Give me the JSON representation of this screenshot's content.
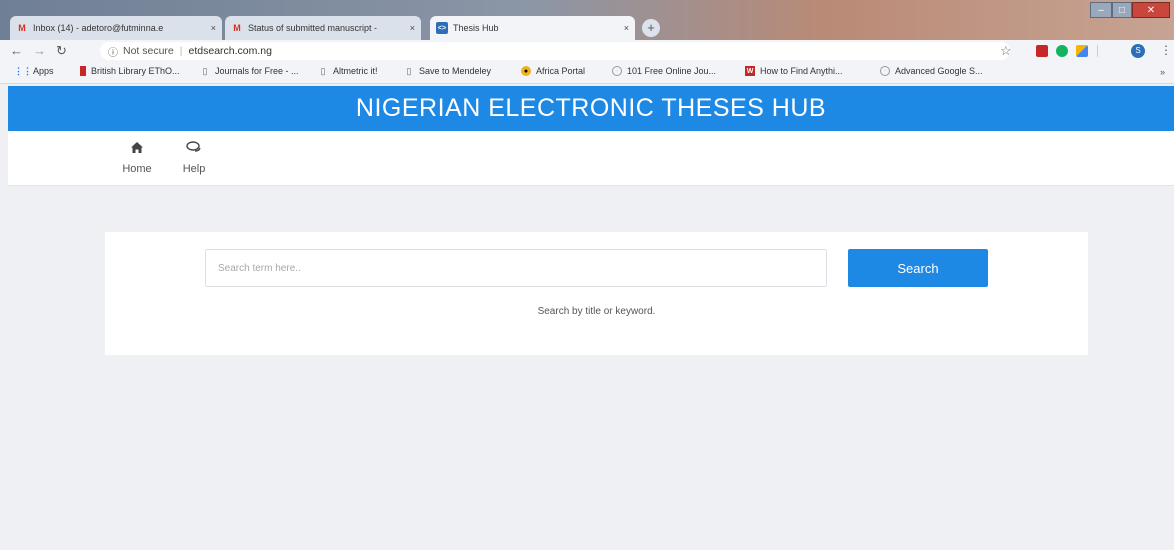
{
  "browser": {
    "tabs": [
      {
        "title": "Inbox (14) - adetoro@futminna.e",
        "icon": "gmail-icon",
        "close": "×"
      },
      {
        "title": "Status of submitted manuscript -",
        "icon": "gmail-icon",
        "close": "×"
      },
      {
        "title": "Thesis Hub",
        "icon": "thesis-hub-favicon",
        "close": "×"
      }
    ],
    "new_tab": "+",
    "address": {
      "security": "Not secure",
      "url": "etdsearch.com.ng"
    },
    "bookmarks": [
      {
        "label": "Apps",
        "icon": "apps-grid-icon"
      },
      {
        "label": "British Library EThO...",
        "icon": "bookmark-icon"
      },
      {
        "label": "Journals for Free - ...",
        "icon": "page-icon"
      },
      {
        "label": "Altmetric it!",
        "icon": "page-icon"
      },
      {
        "label": "Save to Mendeley",
        "icon": "page-icon"
      },
      {
        "label": "Africa Portal",
        "icon": "africa-portal-icon"
      },
      {
        "label": "101 Free Online Jou...",
        "icon": "globe-icon"
      },
      {
        "label": "How to Find Anythi...",
        "icon": "w-icon"
      },
      {
        "label": "Advanced Google S...",
        "icon": "globe-icon"
      }
    ],
    "bookmarks_more": "»",
    "profile_initial": "S"
  },
  "site": {
    "title": "NIGERIAN ELECTRONIC THESES HUB",
    "nav": [
      {
        "label": "Home",
        "icon": "home-icon"
      },
      {
        "label": "Help",
        "icon": "chat-bubbles-icon"
      }
    ]
  },
  "search": {
    "placeholder": "Search term here..",
    "button": "Search",
    "hint": "Search by title or keyword."
  },
  "colors": {
    "brand": "#1e88e5",
    "page_bg": "#eef0f4"
  }
}
